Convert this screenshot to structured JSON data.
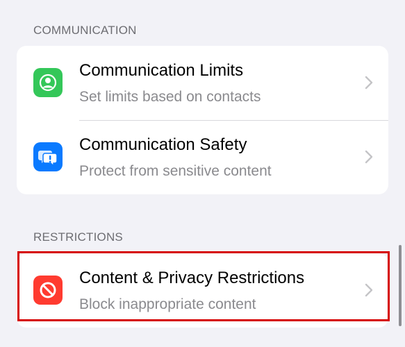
{
  "sections": {
    "communication": {
      "header": "COMMUNICATION",
      "rows": [
        {
          "title": "Communication Limits",
          "subtitle": "Set limits based on contacts",
          "icon": "person-circle-icon",
          "icon_color": "#34c759"
        },
        {
          "title": "Communication Safety",
          "subtitle": "Protect from sensitive content",
          "icon": "chat-bubble-exclamation-icon",
          "icon_color": "#0a7aff"
        }
      ]
    },
    "restrictions": {
      "header": "RESTRICTIONS",
      "rows": [
        {
          "title": "Content & Privacy Restrictions",
          "subtitle": "Block inappropriate content",
          "icon": "no-entry-icon",
          "icon_color": "#ff3b30",
          "highlighted": true
        }
      ]
    }
  },
  "colors": {
    "background": "#f2f2f7",
    "highlight_border": "#d60000"
  }
}
